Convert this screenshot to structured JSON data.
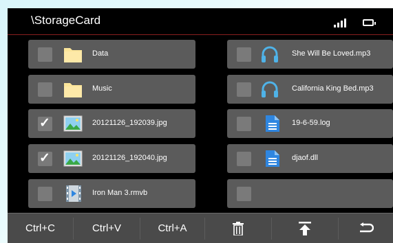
{
  "header": {
    "path": "\\StorageCard"
  },
  "status": {
    "signal_icon": "signal-bars-icon",
    "battery_icon": "battery-icon"
  },
  "files": [
    {
      "name": "Data",
      "type": "folder",
      "checked": false
    },
    {
      "name": "Music",
      "type": "folder",
      "checked": false
    },
    {
      "name": "20121126_192039.jpg",
      "type": "image",
      "checked": true
    },
    {
      "name": "20121126_192040.jpg",
      "type": "image",
      "checked": true
    },
    {
      "name": "Iron Man 3.rmvb",
      "type": "video",
      "checked": false
    },
    {
      "name": "She Will Be Loved.mp3",
      "type": "audio",
      "checked": false
    },
    {
      "name": "California King Bed.mp3",
      "type": "audio",
      "checked": false
    },
    {
      "name": "19-6-59.log",
      "type": "document",
      "checked": false
    },
    {
      "name": "djaof.dll",
      "type": "document",
      "checked": false
    },
    {
      "name": "",
      "type": "empty",
      "checked": false
    }
  ],
  "toolbar": {
    "copy_label": "Ctrl+C",
    "paste_label": "Ctrl+V",
    "select_all_label": "Ctrl+A",
    "delete_icon": "trash-icon",
    "top_icon": "scroll-to-top-icon",
    "back_icon": "back-arrow-icon"
  },
  "colors": {
    "accent_line": "#8a1f1f",
    "tile": "#5b5b5b",
    "folder": "#fbe59a",
    "audio": "#4fb3e8",
    "document": "#2f86e0"
  }
}
